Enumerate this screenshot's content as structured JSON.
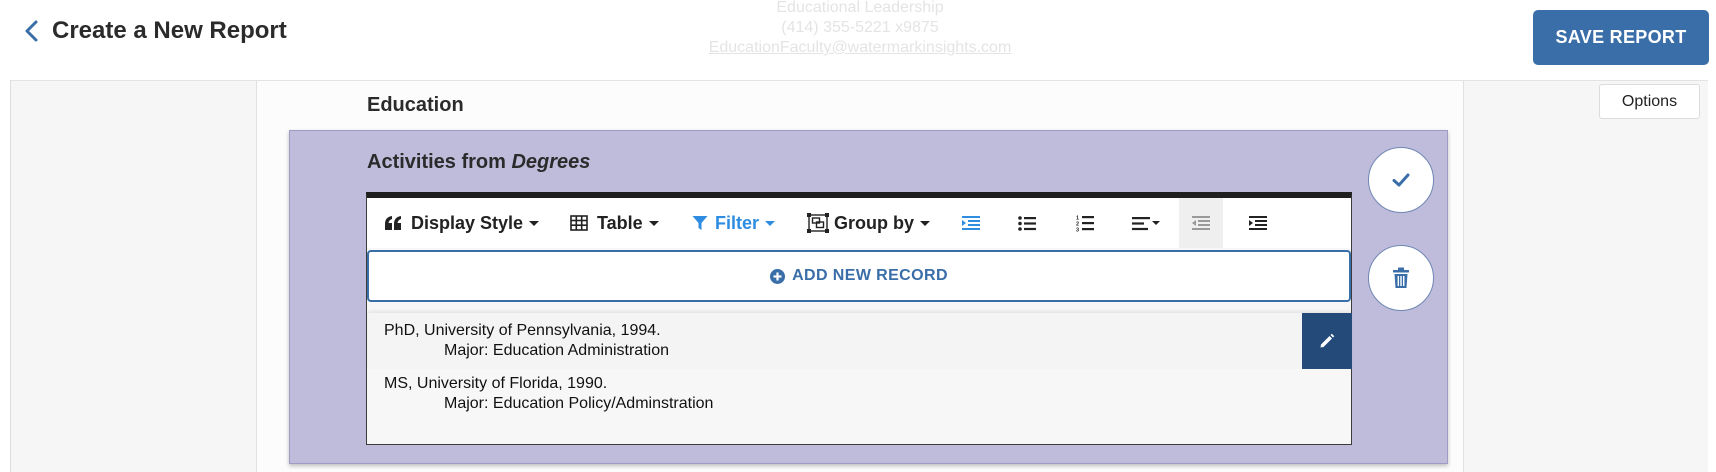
{
  "header": {
    "title": "Create a New Report",
    "save_label": "SAVE REPORT",
    "watermark": {
      "line1": "Educational Leadership",
      "line2": "(414) 355-5221 x9875",
      "line3": "EducationFaculty@watermarkinsights.com"
    }
  },
  "options_label": "Options",
  "section": {
    "title": "Education",
    "panel": {
      "title_prefix": "Activities from ",
      "title_source": "Degrees",
      "toolbar": {
        "display_style": "Display Style",
        "table": "Table",
        "filter": "Filter",
        "group_by": "Group by"
      },
      "add_record_label": "ADD NEW RECORD",
      "records": [
        {
          "line1": "PhD, University of Pennsylvania, 1994.",
          "line2": "Major: Education Administration"
        },
        {
          "line1": "MS, University of Florida, 1990.",
          "line2": "Major: Education Policy/Adminstration"
        }
      ]
    }
  },
  "colors": {
    "accent": "#3a6ea8",
    "filter_active": "#2e8de0",
    "panel_bg": "#bfbcdb",
    "edit_button": "#234a78"
  },
  "icons": {
    "back": "chevron-left-icon",
    "confirm": "check-icon",
    "delete": "trash-icon",
    "edit": "pencil-icon",
    "add": "plus-circle-icon"
  }
}
